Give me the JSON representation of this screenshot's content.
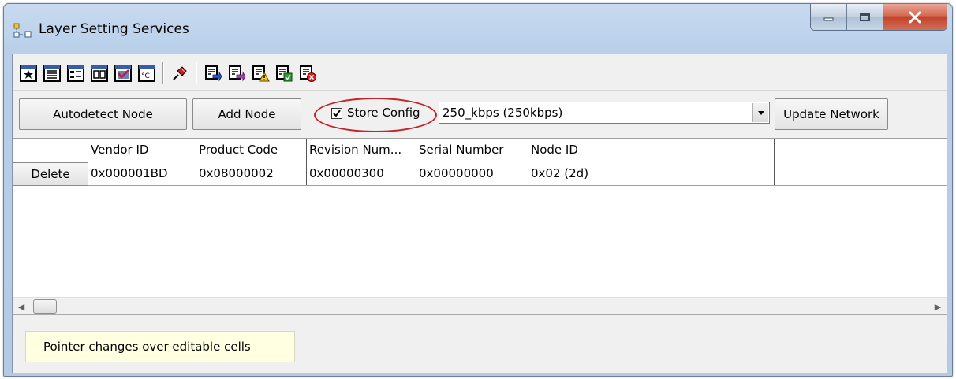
{
  "window": {
    "title": "Layer Setting Services"
  },
  "toolbar": {
    "icons": [
      "star-icon",
      "list-icon",
      "detail-icon",
      "grid-icon",
      "edit-icon",
      "temperature-icon",
      "pin-icon",
      "node-blue-icon",
      "node-purple-icon",
      "node-warning-icon",
      "node-green-icon",
      "node-error-icon"
    ]
  },
  "actions": {
    "autodetect_label": "Autodetect Node",
    "add_node_label": "Add Node",
    "store_config_label": "Store Config",
    "store_config_checked": true,
    "baud_rate_value": "250_kbps (250kbps)",
    "update_network_label": "Update Network"
  },
  "table": {
    "columns": [
      "Vendor ID",
      "Product Code",
      "Revision Num...",
      "Serial Number",
      "Node ID"
    ],
    "rows": [
      {
        "action_label": "Delete",
        "cells": [
          "0x000001BD",
          "0x08000002",
          "0x00000300",
          "0x00000000",
          "0x02 (2d)"
        ]
      }
    ]
  },
  "status": {
    "hint": "Pointer changes over editable cells"
  },
  "colors": {
    "highlight_ellipse": "#c0242c",
    "close_button": "#c3412a",
    "hint_background": "#ffffe1"
  }
}
